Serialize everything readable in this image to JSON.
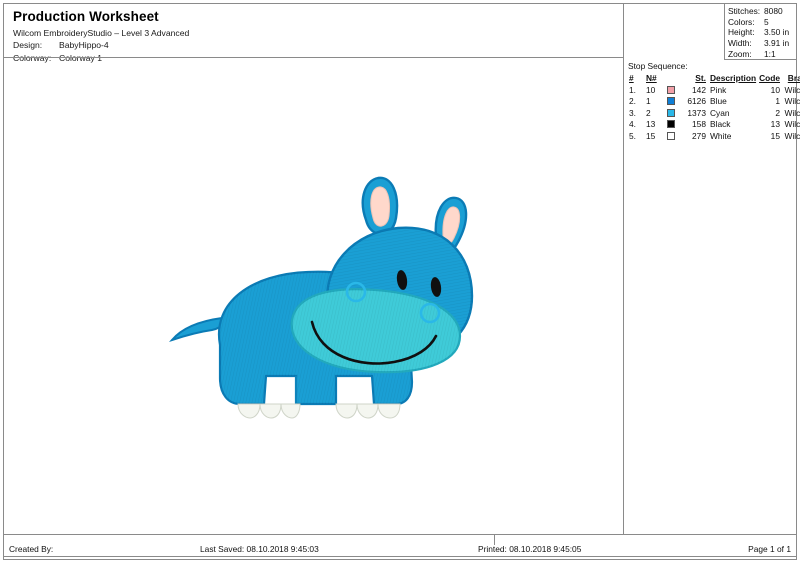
{
  "header": {
    "title": "Production Worksheet",
    "software": "Wilcom EmbroideryStudio – Level 3 Advanced",
    "design_label": "Design:",
    "design_value": "BabyHippo-4",
    "colorway_label": "Colorway:",
    "colorway_value": "Colorway 1"
  },
  "info": {
    "stitches_label": "Stitches:",
    "stitches_value": "8080",
    "colors_label": "Colors:",
    "colors_value": "5",
    "height_label": "Height:",
    "height_value": "3.50 in",
    "width_label": "Width:",
    "width_value": "3.91 in",
    "zoom_label": "Zoom:",
    "zoom_value": "1:1"
  },
  "stop_sequence": {
    "title": "Stop Sequence:",
    "columns": {
      "index": "#",
      "needle": "N#",
      "stitches": "St.",
      "description": "Description",
      "code": "Code",
      "brand": "Brand"
    },
    "rows": [
      {
        "index": "1.",
        "needle": "10",
        "swatch": "#f2a0a8",
        "stitches": "142",
        "description": "Pink",
        "code": "10",
        "brand": "Wilcom"
      },
      {
        "index": "2.",
        "needle": "1",
        "swatch": "#0f7fd6",
        "stitches": "6126",
        "description": "Blue",
        "code": "1",
        "brand": "Wilcom"
      },
      {
        "index": "3.",
        "needle": "2",
        "swatch": "#2ab8e8",
        "stitches": "1373",
        "description": "Cyan",
        "code": "2",
        "brand": "Wilcom"
      },
      {
        "index": "4.",
        "needle": "13",
        "swatch": "#000000",
        "stitches": "158",
        "description": "Black",
        "code": "13",
        "brand": "Wilcom"
      },
      {
        "index": "5.",
        "needle": "15",
        "swatch": "#ffffff",
        "stitches": "279",
        "description": "White",
        "code": "15",
        "brand": "Wilcom"
      }
    ]
  },
  "footer": {
    "created_by": "Created By:",
    "last_saved": "Last Saved: 08.10.2018 9:45:03",
    "printed": "Printed: 08.10.2018 9:45:05",
    "page": "Page 1 of 1"
  },
  "artwork": {
    "name": "baby-hippo-embroidery",
    "body_color": "#1a9fd4",
    "body_shade": "#0f86bd",
    "muzzle_color": "#3fcbd8",
    "muzzle_shade": "#2fb4c6",
    "ear_inner_color": "#ffd8cb",
    "eye_color": "#101010",
    "nail_color": "#f4f6f0",
    "outline_color": "#0b7bb5"
  }
}
